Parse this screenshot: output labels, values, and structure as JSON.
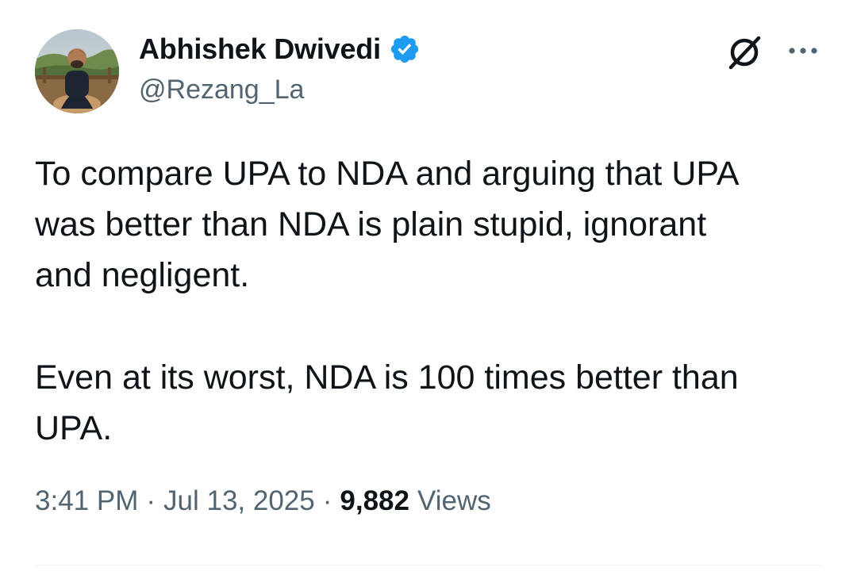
{
  "author": {
    "display_name": "Abhishek Dwivedi",
    "handle": "@Rezang_La",
    "verified": true
  },
  "header_icons": [
    "grok-icon",
    "more-icon"
  ],
  "tweet": {
    "paragraphs": [
      [
        "To compare UPA to NDA and arguing that UPA",
        "was better than NDA is plain stupid, ignorant",
        "and negligent."
      ],
      [
        "Even at its worst, NDA is 100 times better than",
        "UPA."
      ]
    ]
  },
  "meta": {
    "time": "3:41 PM",
    "separator": "·",
    "date": "Jul 13, 2025",
    "views_count": "9,882",
    "views_label": "Views"
  },
  "colors": {
    "primary_text": "#0f1419",
    "secondary_text": "#536471",
    "verified_blue": "#1d9bf0",
    "divider": "#eff3f4"
  }
}
